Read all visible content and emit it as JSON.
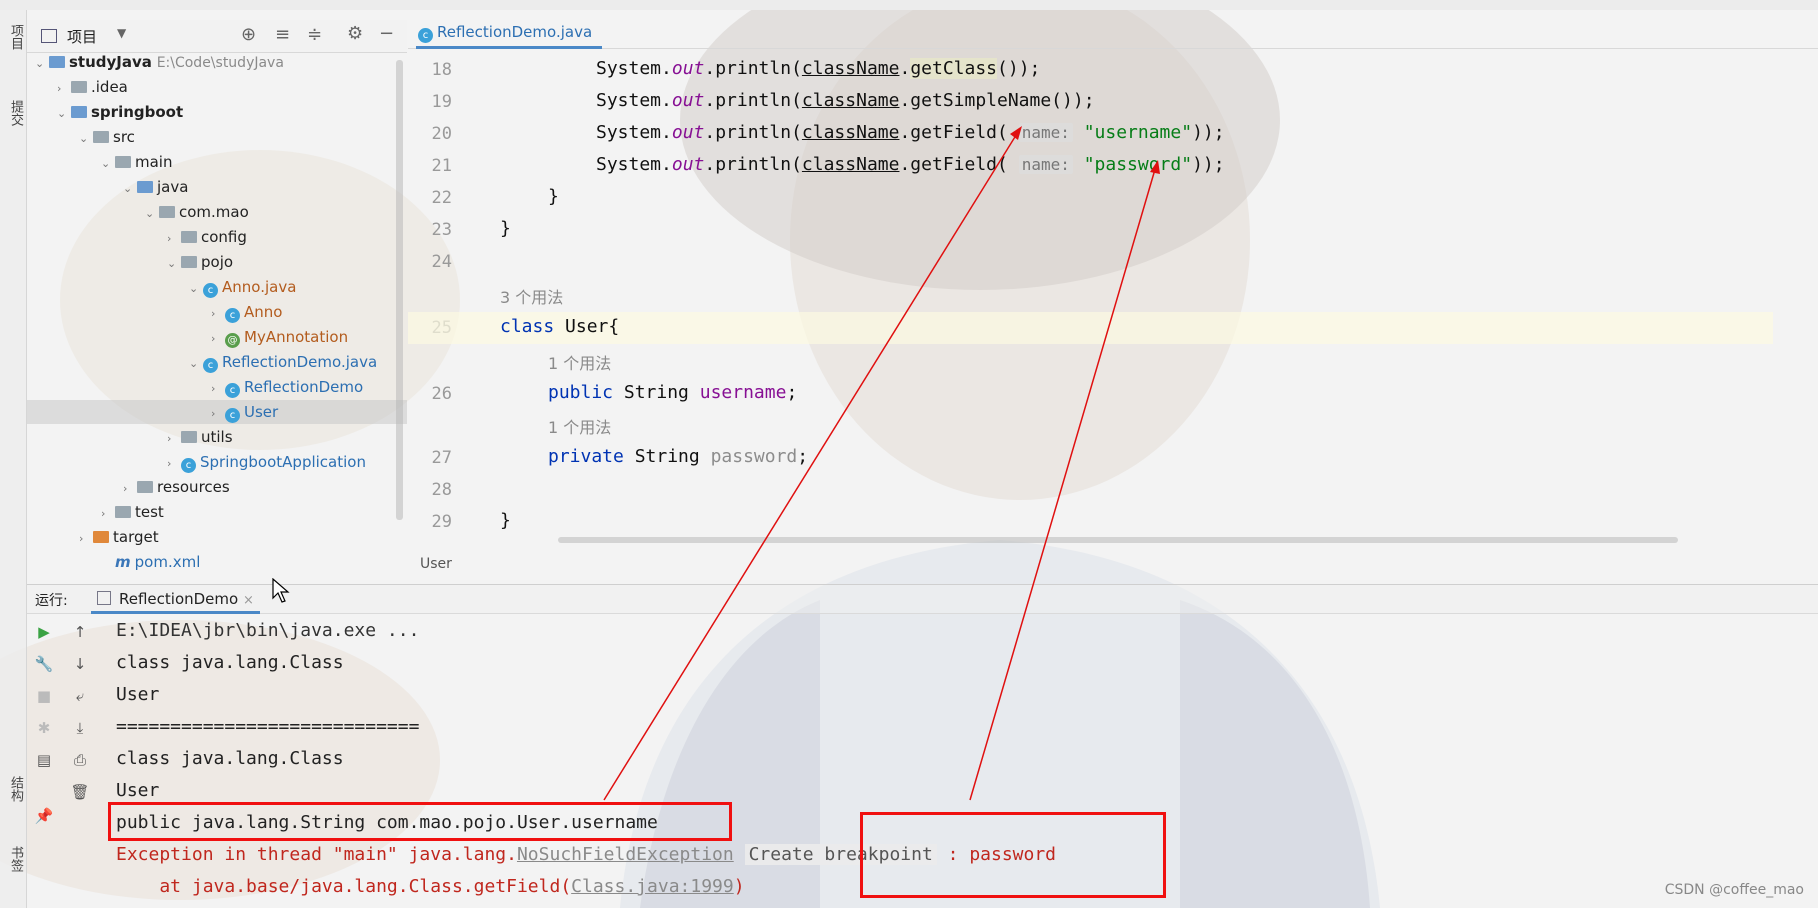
{
  "editor_tab": {
    "label": "ReflectionDemo.java"
  },
  "left_strip": {
    "top_label": "项目",
    "mid_label": "提交",
    "bottom_label1": "结构",
    "bottom_label2": "书签"
  },
  "project": {
    "header_label": "项目",
    "tree": [
      {
        "label": "studyJava",
        "extra": "E:\\Code\\studyJava",
        "bold": true
      },
      {
        "label": ".idea"
      },
      {
        "label": "springboot",
        "bold": true
      },
      {
        "label": "src"
      },
      {
        "label": "main"
      },
      {
        "label": "java"
      },
      {
        "label": "com.mao"
      },
      {
        "label": "config"
      },
      {
        "label": "pojo"
      },
      {
        "label": "Anno.java"
      },
      {
        "label": "Anno"
      },
      {
        "label": "MyAnnotation"
      },
      {
        "label": "ReflectionDemo.java"
      },
      {
        "label": "ReflectionDemo"
      },
      {
        "label": "User"
      },
      {
        "label": "utils"
      },
      {
        "label": "SpringbootApplication"
      },
      {
        "label": "resources"
      },
      {
        "label": "test"
      },
      {
        "label": "target"
      },
      {
        "label": "pom.xml"
      }
    ]
  },
  "editor": {
    "line_numbers": [
      "18",
      "19",
      "20",
      "21",
      "22",
      "23",
      "24",
      "25",
      "26",
      "27",
      "28",
      "29"
    ],
    "usage_3": "3 个用法",
    "usage_1a": "1 个用法",
    "usage_1b": "1 个用法",
    "param_hint": "name:",
    "breadcrumb": "User"
  },
  "run": {
    "label": "运行:",
    "tab_label": "ReflectionDemo",
    "lines": [
      "E:\\IDEA\\jbr\\bin\\java.exe ...",
      "class java.lang.Class",
      "User",
      "============================",
      "class java.lang.Class",
      "User",
      "public java.lang.String com.mao.pojo.User.username"
    ],
    "exception_prefix": "Exception in thread \"main\" java.lang.",
    "exception_name": "NoSuchFieldException",
    "create_breakpoint": "Create breakpoint",
    "exception_suffix": ": password",
    "stack_prefix": "    at java.base/java.lang.Class.getField(",
    "stack_link": "Class.java:1999",
    "stack_suffix": ")"
  },
  "watermark": "CSDN @coffee_mao"
}
